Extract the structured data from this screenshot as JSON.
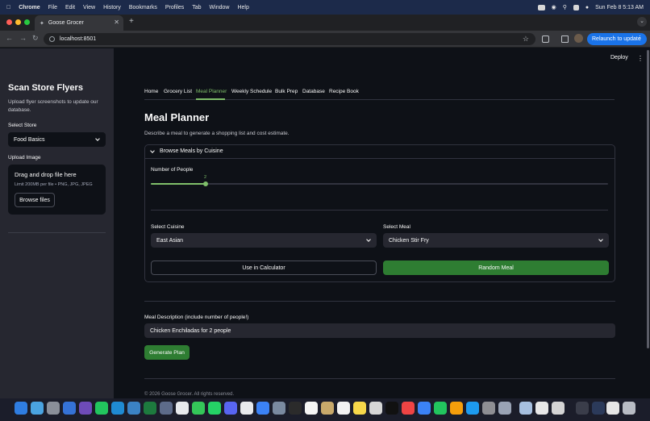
{
  "menubar": {
    "app": "Chrome",
    "items": [
      "File",
      "Edit",
      "View",
      "History",
      "Bookmarks",
      "Profiles",
      "Tab",
      "Window",
      "Help"
    ],
    "datetime": "Sun Feb 8  5:13 AM"
  },
  "browser": {
    "tab_title": "Goose Grocer",
    "url": "localhost:8501",
    "relaunch_label": "Relaunch to update"
  },
  "header": {
    "deploy_label": "Deploy"
  },
  "sidebar": {
    "title": "Scan Store Flyers",
    "description": "Upload flyer screenshots to update our database.",
    "store_label": "Select Store",
    "store_value": "Food Basics",
    "upload_label": "Upload Image",
    "dropzone_title": "Drag and drop file here",
    "dropzone_sub": "Limit 200MB per file • PNG, JPG, JPEG",
    "browse_label": "Browse files"
  },
  "tabs": [
    {
      "label": "Home"
    },
    {
      "label": "Grocery List"
    },
    {
      "label": "Meal Planner",
      "active": true
    },
    {
      "label": "Weekly Schedule"
    },
    {
      "label": "Bulk Prep"
    },
    {
      "label": "Database"
    },
    {
      "label": "Recipe Book"
    }
  ],
  "main": {
    "title": "Meal Planner",
    "description": "Describe a meal to generate a shopping list and cost estimate.",
    "expander_title": "Browse Meals by Cuisine",
    "people_label": "Number of People",
    "people_value": "2",
    "people_fraction": 0.12,
    "cuisine_label": "Select Cuisine",
    "cuisine_value": "East Asian",
    "meal_label": "Select Meal",
    "meal_value": "Chicken Stir Fry",
    "calc_button": "Use in Calculator",
    "random_button": "Random Meal",
    "meal_desc_label": "Meal Description (include number of people!)",
    "meal_desc_value": "Chicken Enchiladas for 2 people",
    "generate_button": "Generate Plan",
    "footer": "© 2026 Goose Grocer. All rights reserved."
  },
  "colors": {
    "accent": "#7fbf6a",
    "button_green": "#2e7d32",
    "sidebar_bg": "#262730",
    "main_bg": "#0e1117"
  }
}
